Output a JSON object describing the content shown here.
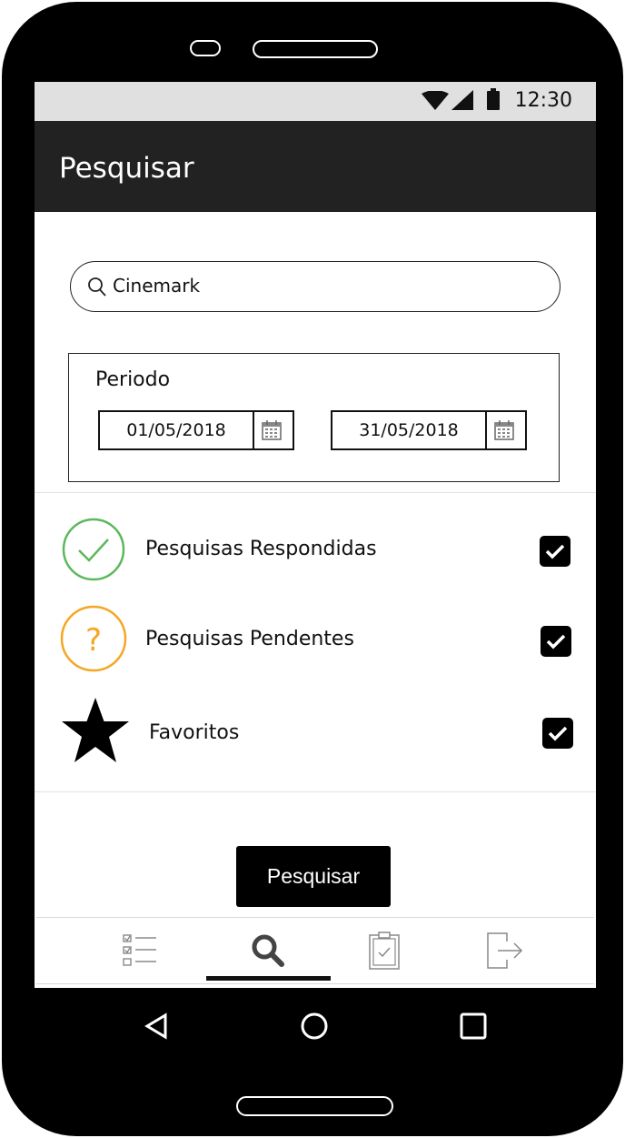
{
  "status_bar": {
    "time": "12:30",
    "icons": [
      "wifi-icon",
      "signal-icon",
      "battery-icon"
    ]
  },
  "app_bar": {
    "title": "Pesquisar"
  },
  "search": {
    "value": "Cinemark",
    "icon": "search-icon"
  },
  "period": {
    "label": "Periodo",
    "start_date": "01/05/2018",
    "end_date": "31/05/2018",
    "picker_icon": "calendar-icon"
  },
  "filters": [
    {
      "label": "Pesquisas Respondidas",
      "icon": "check-circle-icon",
      "icon_color": "#5cb85c",
      "checked": true
    },
    {
      "label": "Pesquisas Pendentes",
      "icon": "question-circle-icon",
      "icon_color": "#f5a623",
      "checked": true
    },
    {
      "label": "Favoritos",
      "icon": "star-icon",
      "icon_color": "#000000",
      "checked": true
    }
  ],
  "submit_button": {
    "label": "Pesquisar"
  },
  "bottom_nav": {
    "items": [
      "checklist-icon",
      "search-icon",
      "clipboard-check-icon",
      "logout-icon"
    ],
    "active_index": 1
  },
  "system_nav": {
    "items": [
      "back-icon",
      "home-icon",
      "recents-icon"
    ]
  }
}
